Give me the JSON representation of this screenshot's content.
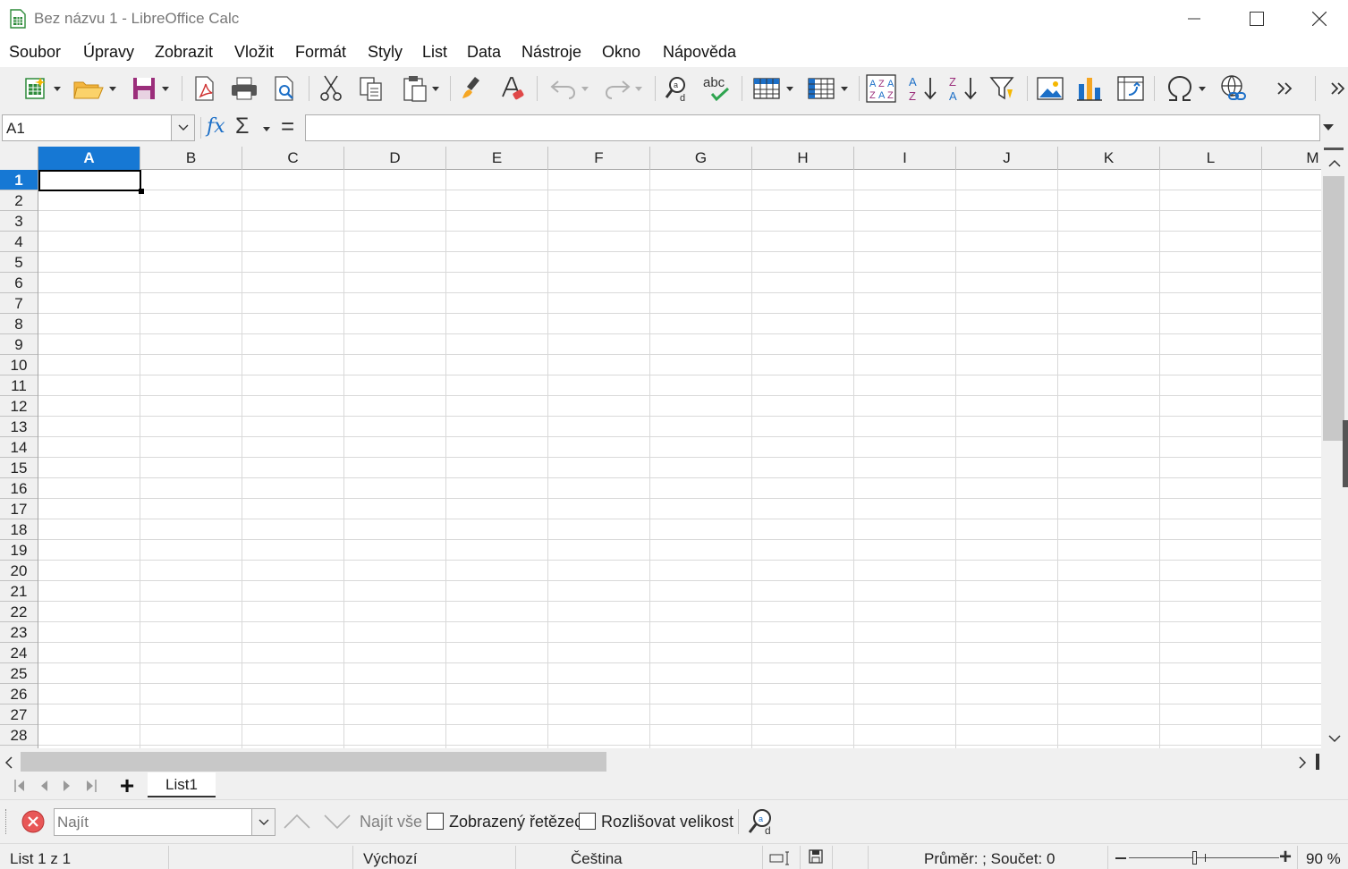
{
  "window": {
    "title": "Bez názvu 1 - LibreOffice Calc",
    "app_icon": "calc-document-icon"
  },
  "menu": [
    "Soubor",
    "Úpravy",
    "Zobrazit",
    "Vložit",
    "Formát",
    "Styly",
    "List",
    "Data",
    "Nástroje",
    "Okno",
    "Nápověda"
  ],
  "toolbar": {
    "icons": [
      "new-icon",
      "open-icon",
      "save-icon",
      "export-pdf-icon",
      "print-icon",
      "print-preview-icon",
      "cut-icon",
      "copy-icon",
      "paste-icon",
      "clone-formatting-icon",
      "clear-formatting-icon",
      "undo-icon",
      "redo-icon",
      "find-replace-icon",
      "spelling-icon",
      "row-icon",
      "column-icon",
      "sort-icon",
      "sort-ascending-icon",
      "sort-descending-icon",
      "autofilter-icon",
      "insert-image-icon",
      "insert-chart-icon",
      "pivot-table-icon",
      "special-character-icon",
      "hyperlink-icon",
      "more-icon"
    ]
  },
  "formula_bar": {
    "name_box": "A1",
    "fx": "fx",
    "sum": "Σ",
    "equals": "=",
    "content": ""
  },
  "sheet": {
    "columns": [
      "A",
      "B",
      "C",
      "D",
      "E",
      "F",
      "G",
      "H",
      "I",
      "J",
      "K",
      "L",
      "M"
    ],
    "rows": [
      "1",
      "2",
      "3",
      "4",
      "5",
      "6",
      "7",
      "8",
      "9",
      "10",
      "11",
      "12",
      "13",
      "14",
      "15",
      "16",
      "17",
      "18",
      "19",
      "20",
      "21",
      "22",
      "23",
      "24",
      "25",
      "26",
      "27",
      "28"
    ],
    "selected_cell": "A1"
  },
  "tabs": {
    "sheets": [
      "List1"
    ],
    "add_label": "+"
  },
  "find_toolbar": {
    "placeholder": "Najít",
    "find_all": "Najít vše",
    "formatted_display": "Zobrazený řetězec",
    "match_case": "Rozlišovat velikost"
  },
  "status": {
    "sheet_of": "List 1 z 1",
    "page_style": "Výchozí",
    "language": "Čeština",
    "stats": "Průměr: ; Součet: 0",
    "zoom": "90 %",
    "zoom_level_percent": 90
  }
}
